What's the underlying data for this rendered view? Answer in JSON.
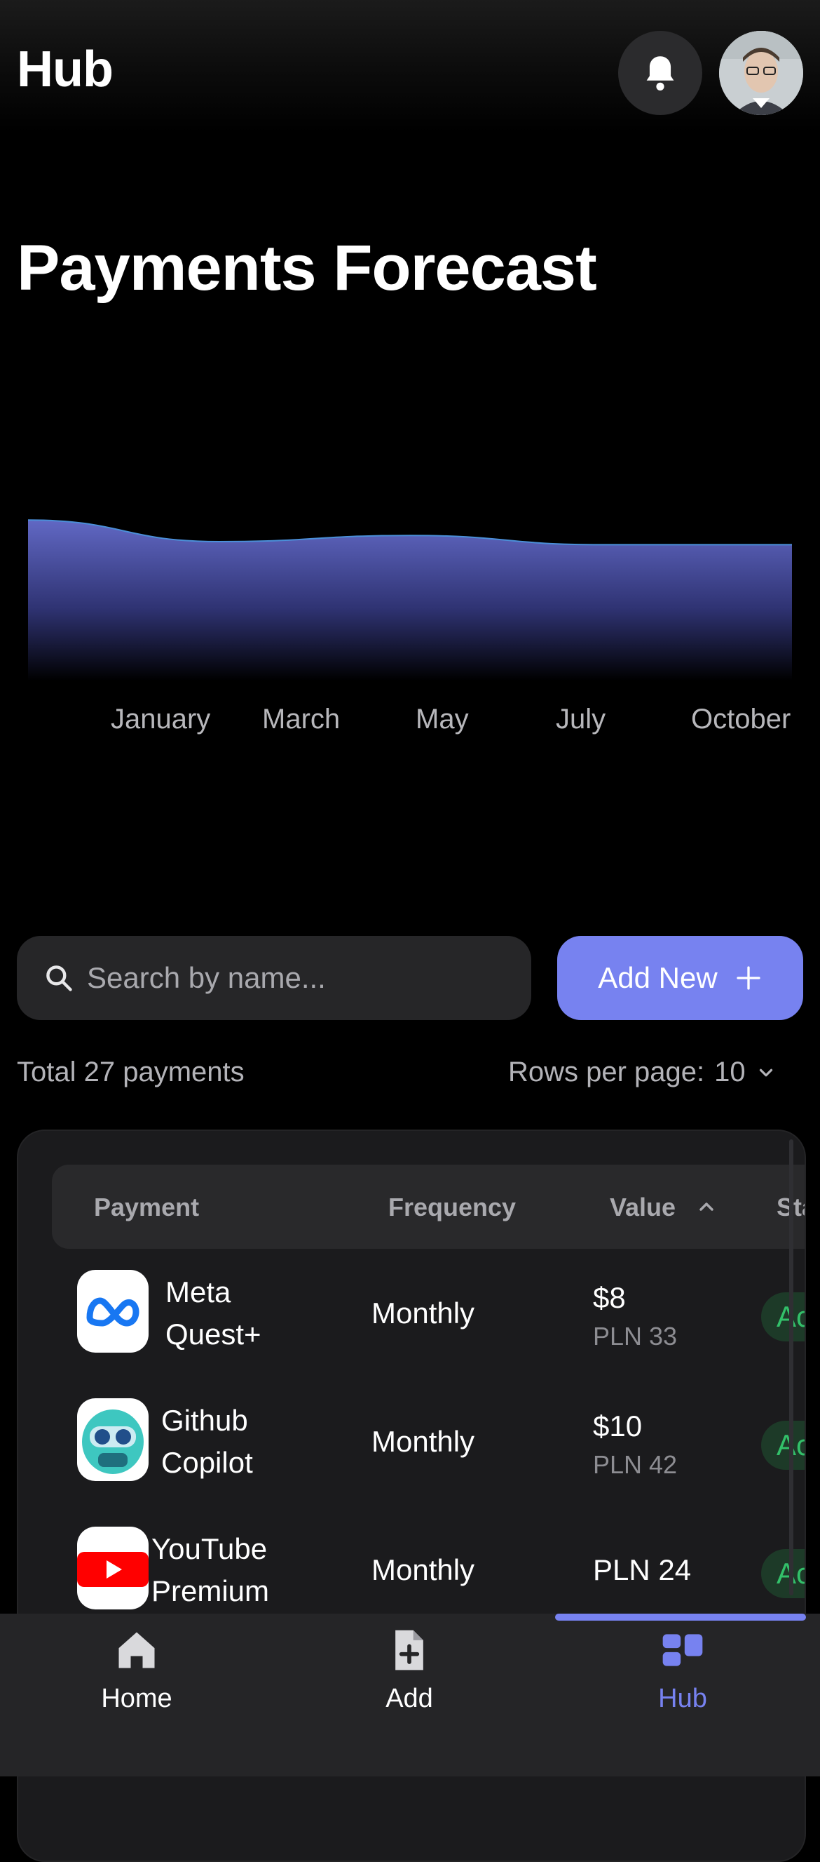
{
  "header": {
    "title": "Hub"
  },
  "page": {
    "title": "Payments Forecast"
  },
  "chart_data": {
    "type": "area",
    "x": [
      "January",
      "March",
      "May",
      "July",
      "October"
    ],
    "series": [
      {
        "values": [
          520,
          450,
          470,
          440,
          440
        ]
      }
    ],
    "ylim": [
      0,
      1000
    ],
    "fill_color": "#6f76d6",
    "grid": false
  },
  "search": {
    "placeholder": "Search by name..."
  },
  "add_button": {
    "label": "Add New"
  },
  "summary": {
    "total": "Total 27 payments",
    "rows_label": "Rows per page:",
    "rows_value": "10"
  },
  "table": {
    "columns": [
      "Payment",
      "Frequency",
      "Value",
      "Stat"
    ],
    "rows": [
      {
        "name_line1": "Meta",
        "name_line2": "Quest+",
        "frequency": "Monthly",
        "value": "$8",
        "value_sub": "PLN 33",
        "status": "Ac"
      },
      {
        "name_line1": "Github",
        "name_line2": "Copilot",
        "frequency": "Monthly",
        "value": "$10",
        "value_sub": "PLN 42",
        "status": "Ac"
      },
      {
        "name_line1": "YouTube",
        "name_line2": "Premium",
        "frequency": "Monthly",
        "value": "PLN 24",
        "value_sub": "",
        "status": "Ac"
      }
    ]
  },
  "tabs": [
    {
      "label": "Home",
      "icon": "home-icon"
    },
    {
      "label": "Add",
      "icon": "add-document-icon"
    },
    {
      "label": "Hub",
      "icon": "hub-icon",
      "active": true
    }
  ],
  "colors": {
    "accent": "#7782f0",
    "status_green": "#33c06a"
  }
}
